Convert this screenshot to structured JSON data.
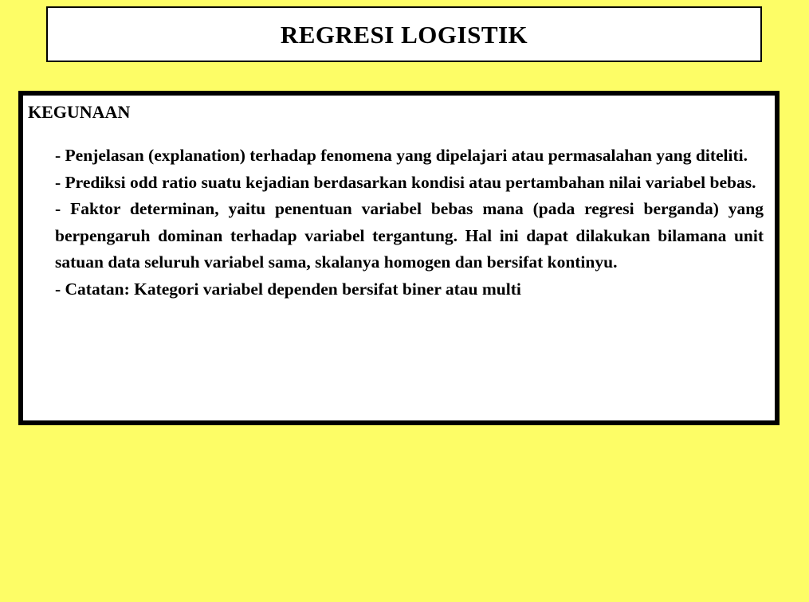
{
  "slide": {
    "background_color": "#fdfd66",
    "box_background_color": "#ffffff",
    "border_color": "#000000",
    "text_color": "#000000"
  },
  "title": {
    "text": "REGRESI LOGISTIK"
  },
  "content": {
    "heading": "KEGUNAAN",
    "paragraphs": [
      {
        "id": "penjelasan",
        "text": "-    Penjelasan (explanation) terhadap fenomena yang dipelajari atau permasalahan yang diteliti."
      },
      {
        "id": "prediksi",
        "text": "-     Prediksi odd ratio suatu kejadian berdasarkan kondisi atau pertambahan nilai variabel bebas."
      },
      {
        "id": "faktor-determinan",
        "text": "-  Faktor determinan, yaitu penentuan variabel bebas mana (pada regresi berganda) yang berpengaruh dominan terhadap variabel tergantung.  Hal ini dapat dilakukan bilamana unit satuan data seluruh variabel sama, skalanya homogen dan bersifat kontinyu."
      },
      {
        "id": "catatan",
        "text": "-  Catatan:  Kategori variabel dependen bersifat biner atau multi"
      }
    ]
  }
}
